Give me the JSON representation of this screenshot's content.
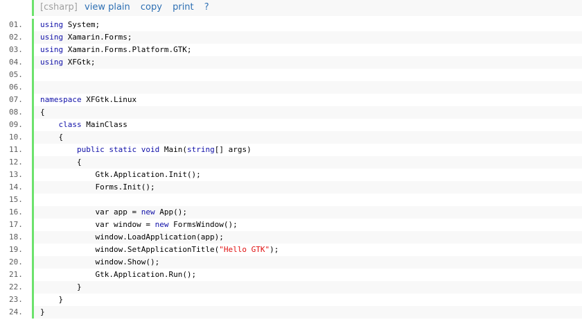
{
  "toolbar": {
    "lang": "[csharp]",
    "view_plain": "view plain",
    "copy": "copy",
    "print": "print",
    "help": "?"
  },
  "lines": [
    {
      "num": "01.",
      "indent": "",
      "parts": [
        {
          "t": "kw",
          "v": "using"
        },
        {
          "t": "tx",
          "v": " System;"
        }
      ]
    },
    {
      "num": "02.",
      "indent": "",
      "parts": [
        {
          "t": "kw",
          "v": "using"
        },
        {
          "t": "tx",
          "v": " Xamarin.Forms;"
        }
      ]
    },
    {
      "num": "03.",
      "indent": "",
      "parts": [
        {
          "t": "kw",
          "v": "using"
        },
        {
          "t": "tx",
          "v": " Xamarin.Forms.Platform.GTK;"
        }
      ]
    },
    {
      "num": "04.",
      "indent": "",
      "parts": [
        {
          "t": "kw",
          "v": "using"
        },
        {
          "t": "tx",
          "v": " XFGtk;"
        }
      ]
    },
    {
      "num": "05.",
      "indent": "",
      "parts": []
    },
    {
      "num": "06.",
      "indent": "",
      "parts": []
    },
    {
      "num": "07.",
      "indent": "",
      "parts": [
        {
          "t": "kw",
          "v": "namespace"
        },
        {
          "t": "tx",
          "v": " XFGtk.Linux"
        }
      ]
    },
    {
      "num": "08.",
      "indent": "",
      "parts": [
        {
          "t": "tx",
          "v": "{"
        }
      ]
    },
    {
      "num": "09.",
      "indent": "    ",
      "parts": [
        {
          "t": "kw",
          "v": "class"
        },
        {
          "t": "tx",
          "v": " MainClass"
        }
      ]
    },
    {
      "num": "10.",
      "indent": "    ",
      "parts": [
        {
          "t": "tx",
          "v": "{"
        }
      ]
    },
    {
      "num": "11.",
      "indent": "        ",
      "parts": [
        {
          "t": "kw",
          "v": "public"
        },
        {
          "t": "tx",
          "v": " "
        },
        {
          "t": "kw",
          "v": "static"
        },
        {
          "t": "tx",
          "v": " "
        },
        {
          "t": "kw",
          "v": "void"
        },
        {
          "t": "tx",
          "v": " Main("
        },
        {
          "t": "kw",
          "v": "string"
        },
        {
          "t": "tx",
          "v": "[] args)"
        }
      ]
    },
    {
      "num": "12.",
      "indent": "        ",
      "parts": [
        {
          "t": "tx",
          "v": "{"
        }
      ]
    },
    {
      "num": "13.",
      "indent": "            ",
      "parts": [
        {
          "t": "tx",
          "v": "Gtk.Application.Init();"
        }
      ]
    },
    {
      "num": "14.",
      "indent": "            ",
      "parts": [
        {
          "t": "tx",
          "v": "Forms.Init();"
        }
      ]
    },
    {
      "num": "15.",
      "indent": "",
      "parts": []
    },
    {
      "num": "16.",
      "indent": "            ",
      "parts": [
        {
          "t": "tx",
          "v": "var app = "
        },
        {
          "t": "kw",
          "v": "new"
        },
        {
          "t": "tx",
          "v": " App();"
        }
      ]
    },
    {
      "num": "17.",
      "indent": "            ",
      "parts": [
        {
          "t": "tx",
          "v": "var window = "
        },
        {
          "t": "kw",
          "v": "new"
        },
        {
          "t": "tx",
          "v": " FormsWindow();"
        }
      ]
    },
    {
      "num": "18.",
      "indent": "            ",
      "parts": [
        {
          "t": "tx",
          "v": "window.LoadApplication(app);"
        }
      ]
    },
    {
      "num": "19.",
      "indent": "            ",
      "parts": [
        {
          "t": "tx",
          "v": "window.SetApplicationTitle("
        },
        {
          "t": "str",
          "v": "\"Hello GTK\""
        },
        {
          "t": "tx",
          "v": ");"
        }
      ]
    },
    {
      "num": "20.",
      "indent": "            ",
      "parts": [
        {
          "t": "tx",
          "v": "window.Show();"
        }
      ]
    },
    {
      "num": "21.",
      "indent": "            ",
      "parts": [
        {
          "t": "tx",
          "v": "Gtk.Application.Run();"
        }
      ]
    },
    {
      "num": "22.",
      "indent": "        ",
      "parts": [
        {
          "t": "tx",
          "v": "}"
        }
      ]
    },
    {
      "num": "23.",
      "indent": "    ",
      "parts": [
        {
          "t": "tx",
          "v": "}"
        }
      ]
    },
    {
      "num": "24.",
      "indent": "",
      "parts": [
        {
          "t": "tx",
          "v": "}"
        }
      ]
    }
  ]
}
